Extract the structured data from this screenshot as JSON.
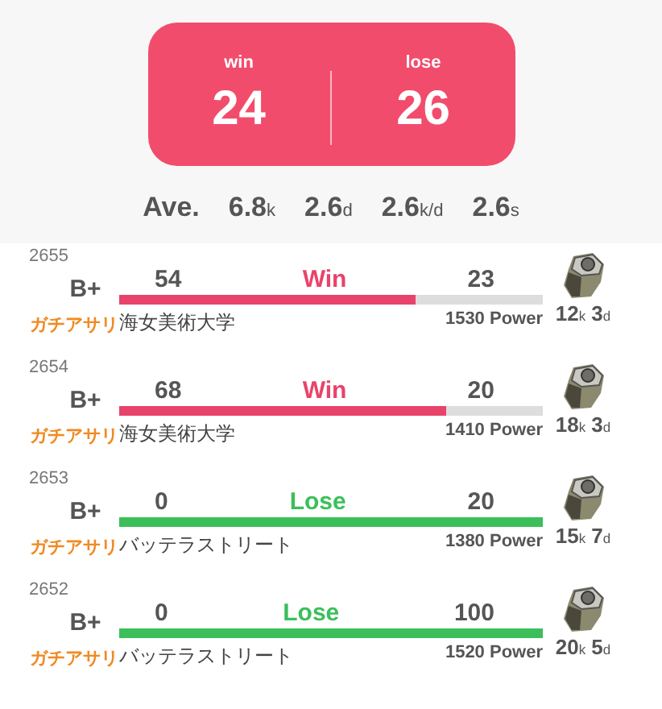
{
  "summary": {
    "win_label": "win",
    "win_count": "24",
    "lose_label": "lose",
    "lose_count": "26"
  },
  "averages": {
    "label": "Ave.",
    "values": [
      "6.8$_{k}$",
      "2.6$_{d}$",
      "2.6$_{k/d}$",
      "2.6$_{s}$"
    ]
  },
  "battles": [
    {
      "number": "2655",
      "rank": "B+",
      "mode": "ガチアサリ",
      "result": "Win",
      "kind": "win",
      "my_score": "54",
      "enemy_score": "23",
      "level": 0.7,
      "stage": "海女美術大学",
      "power": "1530 Power",
      "kd": "12$_{k}$ 3$_{d}$"
    },
    {
      "number": "2654",
      "rank": "B+",
      "mode": "ガチアサリ",
      "result": "Win",
      "kind": "win",
      "my_score": "68",
      "enemy_score": "20",
      "level": 0.77,
      "stage": "海女美術大学",
      "power": "1410 Power",
      "kd": "18$_{k}$ 3$_{d}$"
    },
    {
      "number": "2653",
      "rank": "B+",
      "mode": "ガチアサリ",
      "result": "Lose",
      "kind": "lose",
      "my_score": "0",
      "enemy_score": "20",
      "level": 1,
      "stage": "バッテラストリート",
      "power": "1380 Power",
      "kd": "15$_{k}$ 7$_{d}$"
    },
    {
      "number": "2652",
      "rank": "B+",
      "mode": "ガチアサリ",
      "result": "Lose",
      "kind": "lose",
      "my_score": "0",
      "enemy_score": "100",
      "level": 1,
      "stage": "バッテラストリート",
      "power": "1520 Power",
      "kd": "20$_{k}$ 5$_{d}$"
    }
  ]
}
